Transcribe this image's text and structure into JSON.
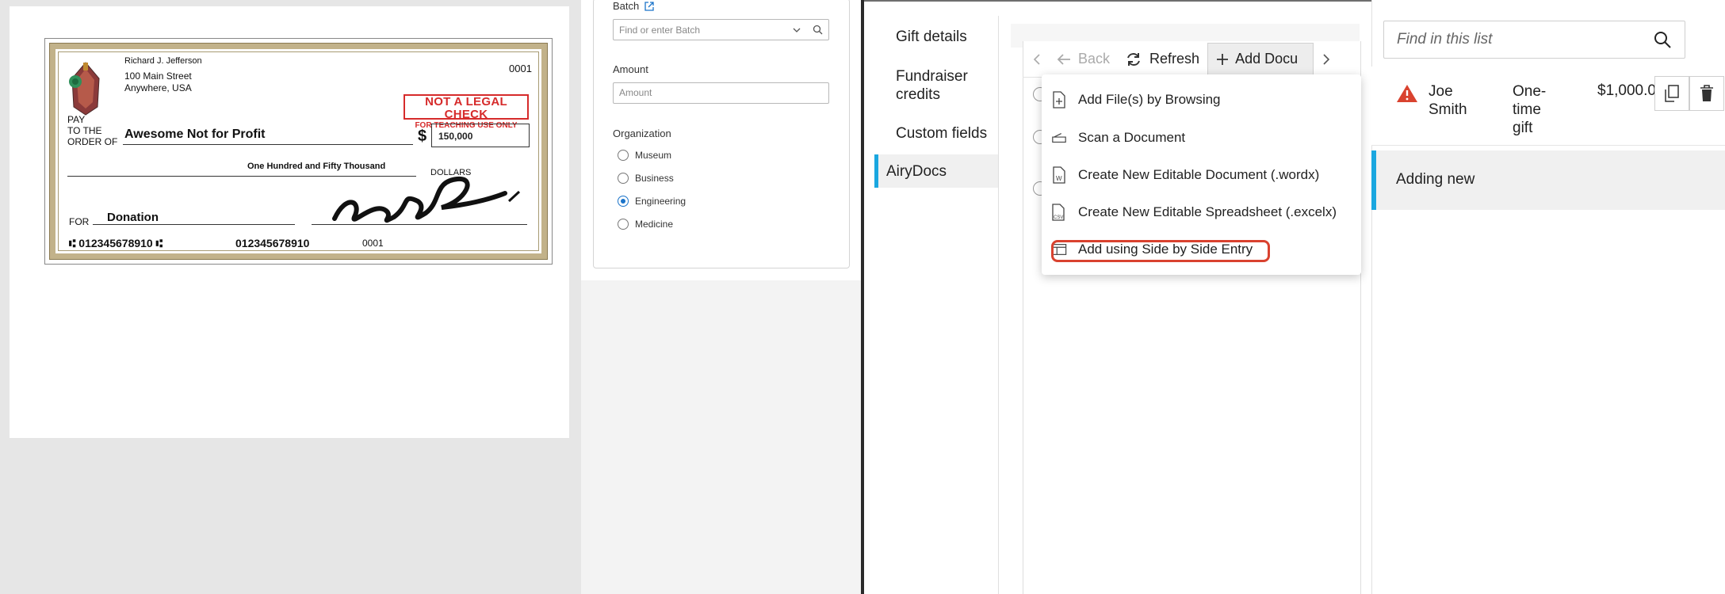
{
  "check": {
    "payer_name": "Richard J. Jefferson",
    "payer_address_1": "100 Main Street",
    "payer_address_2": "Anywhere, USA",
    "check_number": "0001",
    "stamp_line_1": "NOT A LEGAL CHECK",
    "stamp_line_2": "FOR TEACHING USE ONLY",
    "pay_label_1": "PAY",
    "pay_label_2": "TO THE",
    "pay_label_3": "ORDER OF",
    "payee": "Awesome Not for Profit",
    "dollar_sign": "$",
    "amount_numeric": "150,000",
    "amount_words": "One Hundred and Fifty Thousand",
    "dollars_label": "DOLLARS",
    "for_label": "FOR",
    "memo": "Donation",
    "micr_routing": "⑆ 012345678910 ⑆",
    "micr_account": "012345678910",
    "micr_check": "0001"
  },
  "form": {
    "batch_label": "Batch",
    "batch_placeholder": "Find or enter Batch",
    "amount_label": "Amount",
    "amount_placeholder": "Amount",
    "organization_label": "Organization",
    "organizations": [
      {
        "label": "Museum",
        "selected": false
      },
      {
        "label": "Business",
        "selected": false
      },
      {
        "label": "Engineering",
        "selected": true
      },
      {
        "label": "Medicine",
        "selected": false
      }
    ]
  },
  "nav": {
    "items": [
      {
        "label": "Gift details",
        "active": false
      },
      {
        "label": "Fundraiser credits",
        "active": false
      },
      {
        "label": "Custom fields",
        "active": false
      },
      {
        "label": "AiryDocs",
        "active": true
      }
    ]
  },
  "toolbar": {
    "back_label": "Back",
    "refresh_label": "Refresh",
    "add_label": "Add Docu"
  },
  "add_menu": {
    "items": [
      {
        "label": "Add File(s) by Browsing",
        "icon": "file-plus-icon"
      },
      {
        "label": "Scan a Document",
        "icon": "scanner-icon"
      },
      {
        "label": "Create New Editable Document (.wordx)",
        "icon": "word-doc-icon"
      },
      {
        "label": "Create New Editable Spreadsheet (.excelx)",
        "icon": "csv-doc-icon"
      },
      {
        "label": "Add using Side by Side Entry",
        "icon": "side-by-side-icon"
      }
    ],
    "highlighted_index": 4
  },
  "list": {
    "search_placeholder": "Find in this list",
    "row": {
      "name": "Joe Smith",
      "type": "One-time gift",
      "amount": "$1,000.0"
    },
    "new_row_label": "Adding new"
  },
  "colors": {
    "accent_blue": "#1aa7e0",
    "warning_red": "#d9422f",
    "stamp_red": "#d62b2b",
    "check_border": "#c2b28a"
  }
}
